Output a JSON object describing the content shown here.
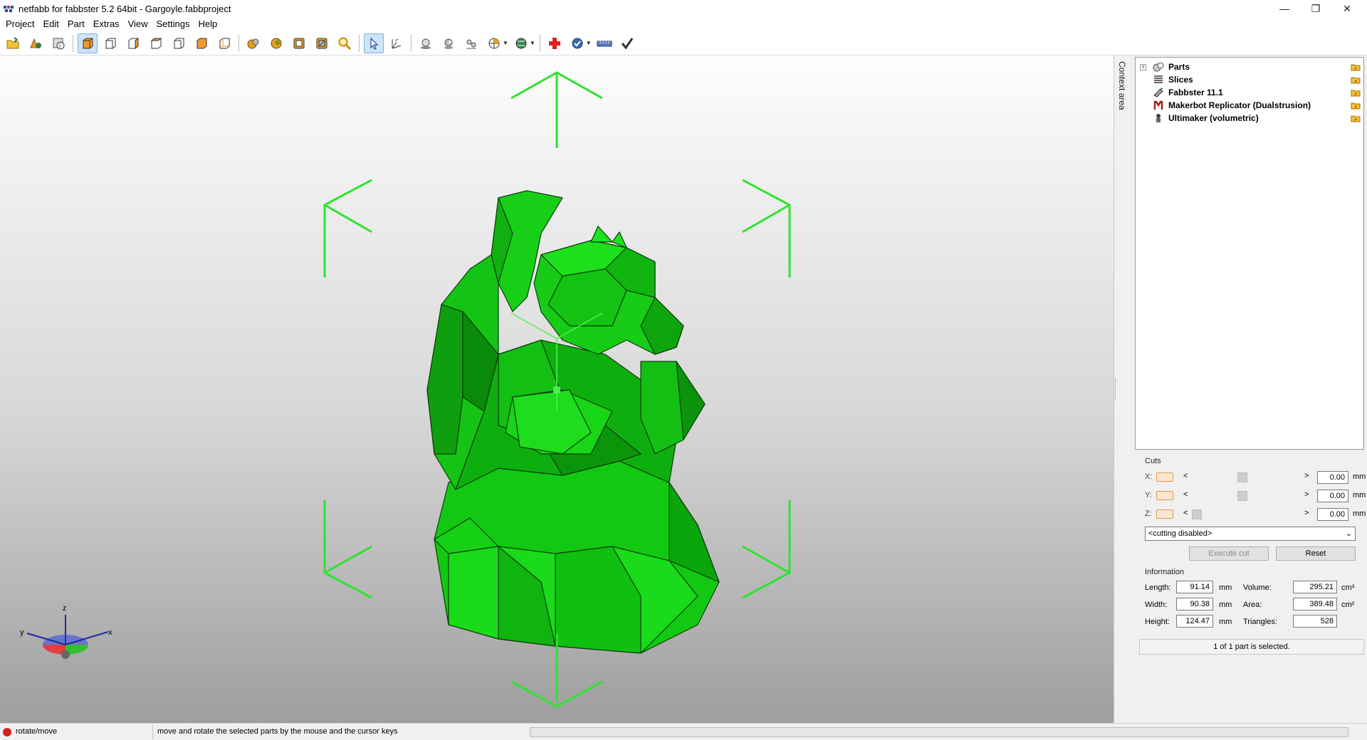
{
  "window": {
    "title": "netfabb for fabbster 5.2 64bit - Gargoyle.fabbproject",
    "minimize": "—",
    "maximize": "❐",
    "close": "✕"
  },
  "menu": [
    "Project",
    "Edit",
    "Part",
    "Extras",
    "View",
    "Settings",
    "Help"
  ],
  "toolbar": {
    "groups": [
      [
        "open-project-icon",
        "add-part-icon",
        "part-info-icon"
      ],
      [
        "view-default-icon",
        "view-front-icon",
        "view-back-icon",
        "view-left-icon",
        "view-right-icon",
        "view-top-icon",
        "view-bottom-icon"
      ],
      [
        "show-parts-icon",
        "show-solid-icon",
        "show-wireframe-icon",
        "show-triangles-icon",
        "zoom-icon"
      ],
      [
        "select-pointer-icon",
        "rotate-mode-icon"
      ],
      [
        "mesh-sphere-icon",
        "shading-icon",
        "measure-icon",
        "section-view-icon",
        "color-scheme-icon"
      ],
      [
        "add-repair-icon",
        "analysis-icon",
        "ruler-icon",
        "checkmark-icon"
      ]
    ],
    "active": "view-default-icon"
  },
  "viewport": {
    "axis_labels": {
      "x": "x",
      "y": "y",
      "z": "z"
    },
    "model_color": "#00d000",
    "handle_color": "#2fe32f"
  },
  "context_tab": "Context area",
  "tree": [
    {
      "label": "Parts",
      "icon": "parts-icon",
      "expander": "+"
    },
    {
      "label": "Slices",
      "icon": "slices-icon"
    },
    {
      "label": "Fabbster 11.1",
      "icon": "fabbster-printer-icon"
    },
    {
      "label": "Makerbot Replicator (Dualstrusion)",
      "icon": "makerbot-printer-icon"
    },
    {
      "label": "Ultimaker (volumetric)",
      "icon": "ultimaker-printer-icon"
    }
  ],
  "cuts": {
    "title": "Cuts",
    "rows": [
      {
        "axis": "X:",
        "value": "0.00",
        "unit": "mm",
        "level": 0.5
      },
      {
        "axis": "Y:",
        "value": "0.00",
        "unit": "mm",
        "level": 0.5
      },
      {
        "axis": "Z:",
        "value": "0.00",
        "unit": "mm",
        "level": 0.0
      }
    ],
    "left_arrow": "<",
    "right_arrow": ">",
    "mode": "<cutting disabled>",
    "execute_label": "Execute cut",
    "reset_label": "Reset"
  },
  "information": {
    "title": "Information",
    "length_label": "Length:",
    "length": "91.14",
    "length_unit": "mm",
    "width_label": "Width:",
    "width": "90.38",
    "width_unit": "mm",
    "height_label": "Height:",
    "height": "124.47",
    "height_unit": "mm",
    "volume_label": "Volume:",
    "volume": "295.21",
    "volume_unit": "cm³",
    "area_label": "Area:",
    "area": "389.48",
    "area_unit": "cm²",
    "triangles_label": "Triangles:",
    "triangles": "528"
  },
  "selection_status": "1 of 1 part is selected.",
  "status": {
    "mode": "rotate/move",
    "message": "move and rotate the selected parts by the mouse and the cursor keys"
  }
}
